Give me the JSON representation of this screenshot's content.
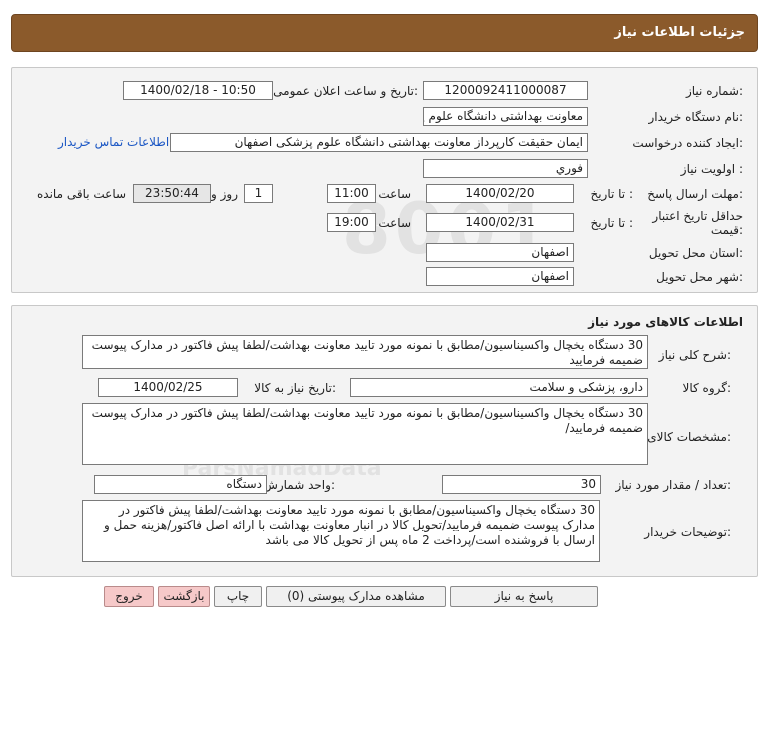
{
  "header": {
    "title": "جزئیات اطلاعات نیاز"
  },
  "info": {
    "need_number_label": "شماره نیاز:",
    "need_number": "1200092411000087",
    "announce_label": "تاریخ و ساعت اعلان عمومی:",
    "announce_value": "1400/02/18 - 10:50",
    "buyer_org_label": "نام دستگاه خریدار:",
    "buyer_org": "معاونت بهداشتی دانشگاه علوم پزشکی اصفهان",
    "requester_label": "ایجاد کننده درخواست:",
    "requester": "ایمان حقیقت کارپرداز معاونت بهداشتی دانشگاه علوم پزشکی اصفهان",
    "contact_link": "اطلاعات تماس خریدار",
    "priority_label": "اولویت نیاز :",
    "priority": "فوري",
    "reply_deadline_label": "مهلت ارسال پاسخ:",
    "to_date_label": "تا تاریخ :",
    "reply_date": "1400/02/20",
    "time_label": "ساعت",
    "reply_time": "11:00",
    "days": "1",
    "days_label": "روز و",
    "remaining": "23:50:44",
    "remaining_label": "ساعت باقی مانده",
    "price_validity_label": "حداقل تاریخ اعتبار قیمت:",
    "to_date_label2": "تا تاریخ :",
    "validity_date": "1400/02/31",
    "time_label2": "ساعت",
    "validity_time": "19:00",
    "province_label": "استان محل تحویل:",
    "province": "اصفهان",
    "city_label": "شهر محل تحویل:",
    "city": "اصفهان"
  },
  "goods": {
    "title": "اطلاعات کالاهای مورد نیاز",
    "summary_label": "شرح کلی نیاز:",
    "summary": "30 دستگاه یخچال واکسیناسیون/مطابق با نمونه مورد تایید معاونت بهداشت/لطفا پیش فاکتور در مدارک پیوست ضمیمه فرمایید",
    "group_label": "گروه کالا:",
    "group": "دارو، پزشکی و سلامت",
    "need_date_label": "تاریخ نیاز به کالا:",
    "need_date": "1400/02/25",
    "specs_label": "مشخصات کالای مورد نیاز:",
    "specs": "30 دستگاه یخچال واکسیناسیون/مطابق با نمونه مورد تایید معاونت بهداشت/لطفا پیش فاکتور در مدارک پیوست ضمیمه فرمایید/",
    "qty_label": "تعداد / مقدار مورد نیاز:",
    "qty": "30",
    "unit_label": "واحد شمارش:",
    "unit": "دستگاه",
    "desc_label": "توضیحات خریدار:",
    "desc": "30 دستگاه یخچال واکسیناسیون/مطابق با نمونه مورد تایید معاونت بهداشت/لطفا پیش فاکتور در مدارک پیوست ضمیمه فرمایید/تحویل کالا در انبار معاونت بهداشت با ارائه اصل فاکتور/هزینه حمل و ارسال با فروشنده است/پرداخت 2 ماه پس از تحویل کالا می باشد"
  },
  "buttons": {
    "reply": "پاسخ به نیاز",
    "attachments": "مشاهده مدارک پیوستی (0)",
    "print": "چاپ",
    "back": "بازگشت",
    "exit": "خروج"
  }
}
